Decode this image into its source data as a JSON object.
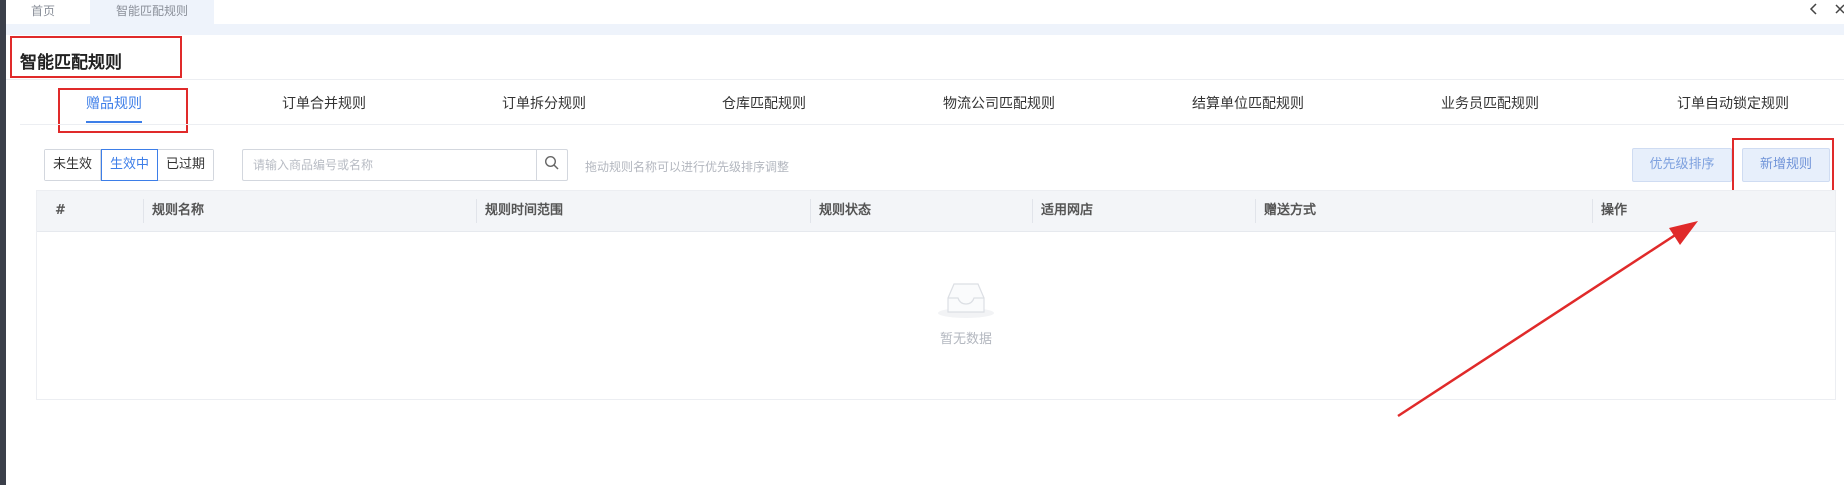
{
  "tabs": {
    "home": "首页",
    "current": "智能匹配规则"
  },
  "page": {
    "title": "智能匹配规则"
  },
  "rule_tabs": [
    {
      "label": "赠品规则",
      "active": true
    },
    {
      "label": "订单合并规则",
      "active": false
    },
    {
      "label": "订单拆分规则",
      "active": false
    },
    {
      "label": "仓库匹配规则",
      "active": false
    },
    {
      "label": "物流公司匹配规则",
      "active": false
    },
    {
      "label": "结算单位匹配规则",
      "active": false
    },
    {
      "label": "业务员匹配规则",
      "active": false
    },
    {
      "label": "订单自动锁定规则",
      "active": false
    }
  ],
  "toolbar": {
    "status_options": [
      "未生效",
      "生效中",
      "已过期"
    ],
    "status_selected": "生效中",
    "search": {
      "placeholder": "请输入商品编号或名称",
      "value": ""
    },
    "hint": "拖动规则名称可以进行优先级排序调整",
    "priority_button": "优先级排序",
    "add_button": "新增规则"
  },
  "table": {
    "columns": [
      "#",
      "规则名称",
      "规则时间范围",
      "规则状态",
      "适用网店",
      "赠送方式",
      "操作"
    ],
    "rows": [],
    "empty_text": "暂无数据"
  },
  "colors": {
    "accent": "#3d7ee8",
    "annotation": "#e02a2a"
  },
  "icons": {
    "search": "search-icon",
    "empty": "empty-inbox-icon",
    "prev": "chevron-left-icon",
    "close": "close-icon"
  }
}
